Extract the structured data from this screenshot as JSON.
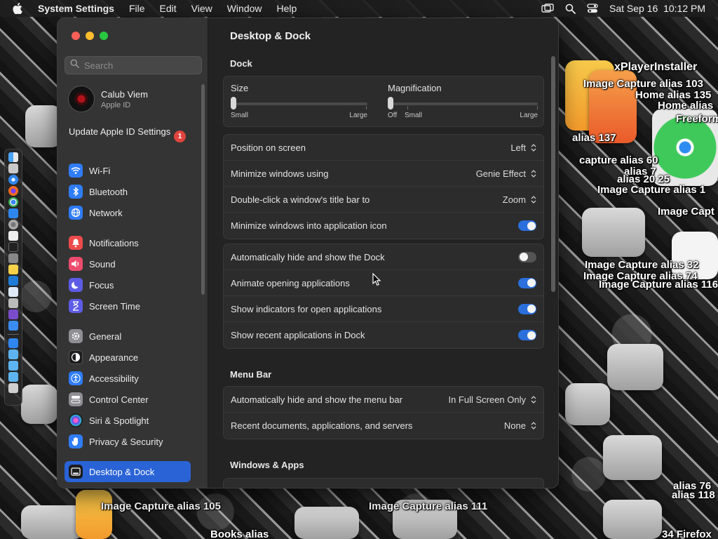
{
  "menubar": {
    "app_name": "System Settings",
    "items": [
      "File",
      "Edit",
      "View",
      "Window",
      "Help"
    ],
    "clock": "Sat Sep 16  10:12 PM"
  },
  "desktop_labels": [
    "xPlayerInstaller",
    "Image Capture alias 103",
    "Home alias 135",
    "Home alias",
    "Freeform",
    "alias 137",
    "capture alias 60",
    "alias 7",
    "alias 20 25",
    "Image Capture alias 1",
    "Image Capt",
    "Image Capture alias 32",
    "Image Capture alias 74",
    "Image Capture alias 116",
    "Image Capture alias 105",
    "Image Capture alias 111",
    "alias 76",
    "alias 118",
    "Books alias",
    "34 Firefox"
  ],
  "sidebar": {
    "search_placeholder": "Search",
    "account": {
      "name": "Calub Viem",
      "subtitle": "Apple ID"
    },
    "update": {
      "label": "Update Apple ID Settings",
      "badge": "1"
    },
    "items": [
      {
        "label": "Wi-Fi",
        "icon": "wifi-icon",
        "color": "#2f7cf6"
      },
      {
        "label": "Bluetooth",
        "icon": "bluetooth-icon",
        "color": "#2f7cf6"
      },
      {
        "label": "Network",
        "icon": "globe-icon",
        "color": "#2f7cf6"
      },
      {
        "label": "Notifications",
        "icon": "bell-icon",
        "color": "#ec4b4b"
      },
      {
        "label": "Sound",
        "icon": "speaker-icon",
        "color": "#ec4b6d"
      },
      {
        "label": "Focus",
        "icon": "moon-icon",
        "color": "#5e5ce6"
      },
      {
        "label": "Screen Time",
        "icon": "hourglass-icon",
        "color": "#5e5ce6"
      },
      {
        "label": "General",
        "icon": "gear-icon",
        "color": "#8e8e93"
      },
      {
        "label": "Appearance",
        "icon": "appearance-icon",
        "color": "#1c1c1e"
      },
      {
        "label": "Accessibility",
        "icon": "accessibility-icon",
        "color": "#2f7cf6"
      },
      {
        "label": "Control Center",
        "icon": "control-center-icon",
        "color": "#8e8e93"
      },
      {
        "label": "Siri & Spotlight",
        "icon": "siri-icon",
        "color": "#1c1c1e"
      },
      {
        "label": "Privacy & Security",
        "icon": "hand-icon",
        "color": "#2f7cf6"
      },
      {
        "label": "Desktop & Dock",
        "icon": "dock-icon",
        "color": "#1c1c1e"
      }
    ]
  },
  "content": {
    "title": "Desktop & Dock",
    "dock_section": "Dock",
    "size": {
      "title": "Size",
      "min_label": "Small",
      "max_label": "Large",
      "level": 0
    },
    "magnification": {
      "title": "Magnification",
      "off_label": "Off",
      "min_label": "Small",
      "max_label": "Large",
      "level": 0
    },
    "position": {
      "label": "Position on screen",
      "value": "Left"
    },
    "minimize_using": {
      "label": "Minimize windows using",
      "value": "Genie Effect"
    },
    "double_click": {
      "label": "Double-click a window's title bar to",
      "value": "Zoom"
    },
    "minimize_into_icon": {
      "label": "Minimize windows into application icon",
      "on": true
    },
    "auto_hide": {
      "label": "Automatically hide and show the Dock",
      "on": false
    },
    "animate": {
      "label": "Animate opening applications",
      "on": true
    },
    "indicators": {
      "label": "Show indicators for open applications",
      "on": true
    },
    "recent_apps": {
      "label": "Show recent applications in Dock",
      "on": true
    },
    "menu_bar_section": "Menu Bar",
    "menu_auto_hide": {
      "label": "Automatically hide and show the menu bar",
      "value": "In Full Screen Only"
    },
    "recent_docs": {
      "label": "Recent documents, applications, and servers",
      "value": "None"
    },
    "windows_apps_section": "Windows & Apps"
  }
}
